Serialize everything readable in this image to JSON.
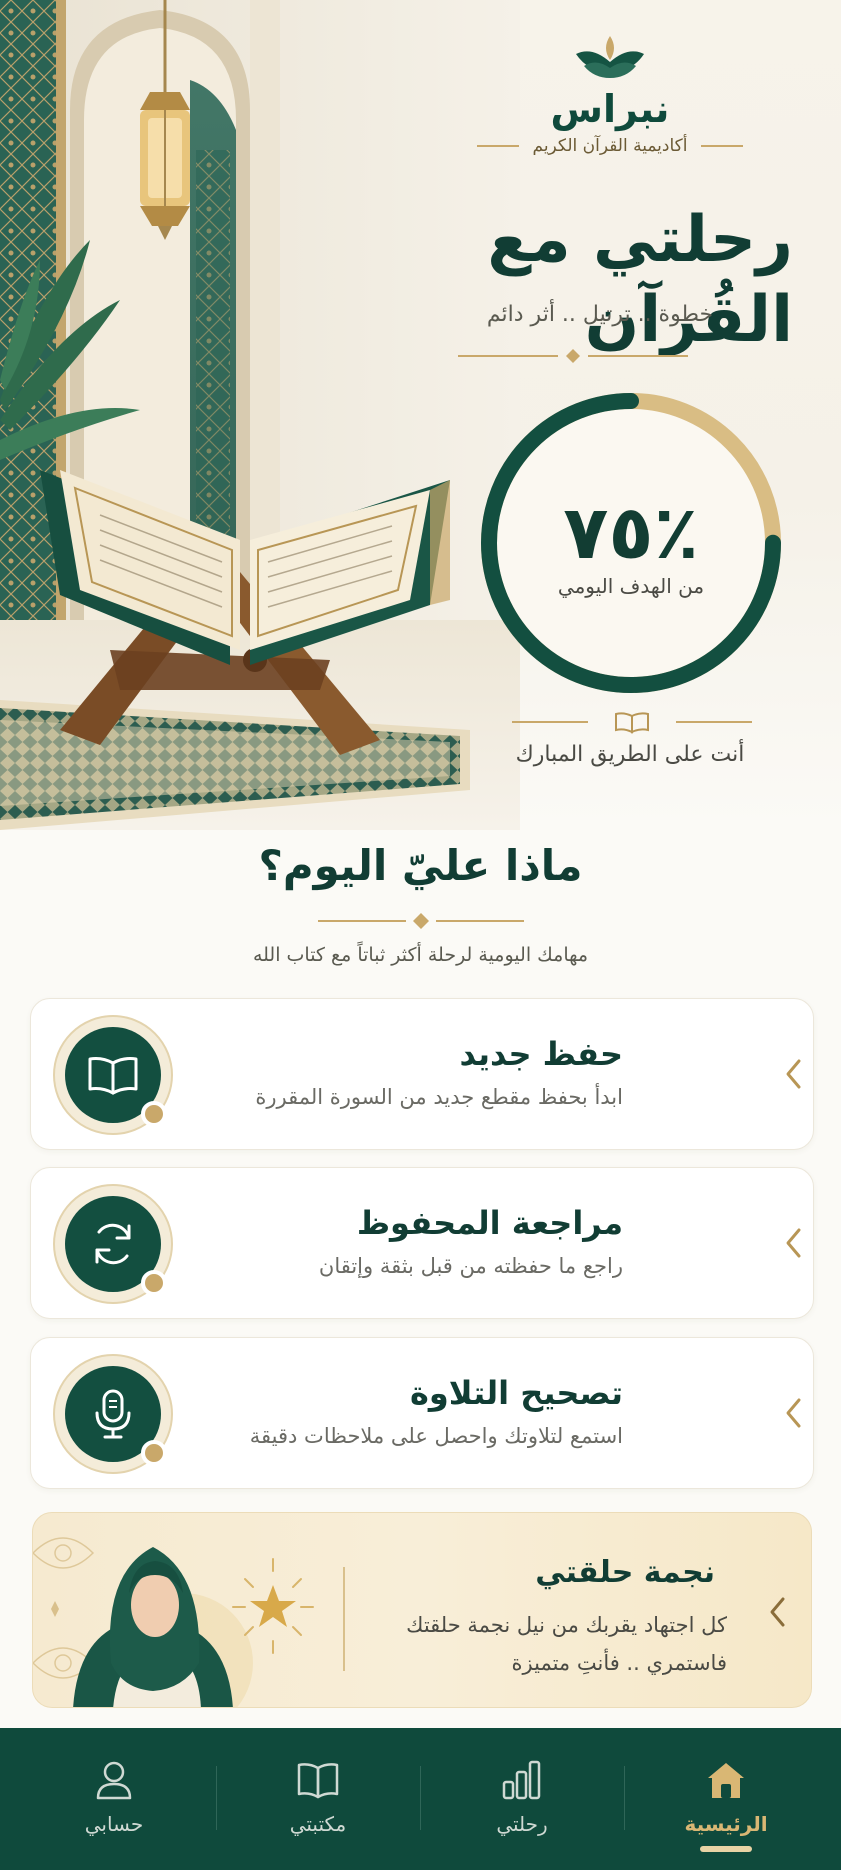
{
  "brand": {
    "name": "نبراس",
    "subtitle": "أكاديمية القرآن الكريم"
  },
  "hero": {
    "title": "رحلتي مع القُرآن",
    "tagline": "خطوة .. ترتيل .. أثر دائم",
    "progress": {
      "percent": 75,
      "value_text": "٪٧٥",
      "caption": "من الهدف اليومي"
    },
    "path_text": "أنت على الطريق المبارك"
  },
  "today": {
    "title": "ماذا عليّ اليوم؟",
    "subtitle": "مهامك اليومية لرحلة أكثر ثباتاً مع كتاب الله",
    "tasks": [
      {
        "title": "حفظ جديد",
        "description": "ابدأ بحفظ مقطع جديد من السورة المقررة",
        "icon": "open-book-icon"
      },
      {
        "title": "مراجعة المحفوظ",
        "description": "راجع ما حفظته من قبل بثقة وإتقان",
        "icon": "refresh-icon"
      },
      {
        "title": "تصحيح التلاوة",
        "description": "استمع لتلاوتك واحصل على ملاحظات دقيقة",
        "icon": "microphone-icon"
      }
    ]
  },
  "star_banner": {
    "title": "نجمة حلقتي",
    "line1": "كل اجتهاد يقربك من نيل نجمة حلقتك",
    "line2": "فاستمري .. فأنتِ متميزة"
  },
  "bottom_nav": {
    "items": [
      {
        "label": "الرئيسية",
        "icon": "home-icon",
        "active": true
      },
      {
        "label": "رحلتي",
        "icon": "bar-chart-icon",
        "active": false
      },
      {
        "label": "مكتبتي",
        "icon": "book-icon",
        "active": false
      },
      {
        "label": "حسابي",
        "icon": "user-icon",
        "active": false
      }
    ]
  },
  "colors": {
    "primary": "#0f4a3c",
    "gold": "#c9a86a",
    "background": "#fbfaf6",
    "text_dark": "#113d34"
  }
}
